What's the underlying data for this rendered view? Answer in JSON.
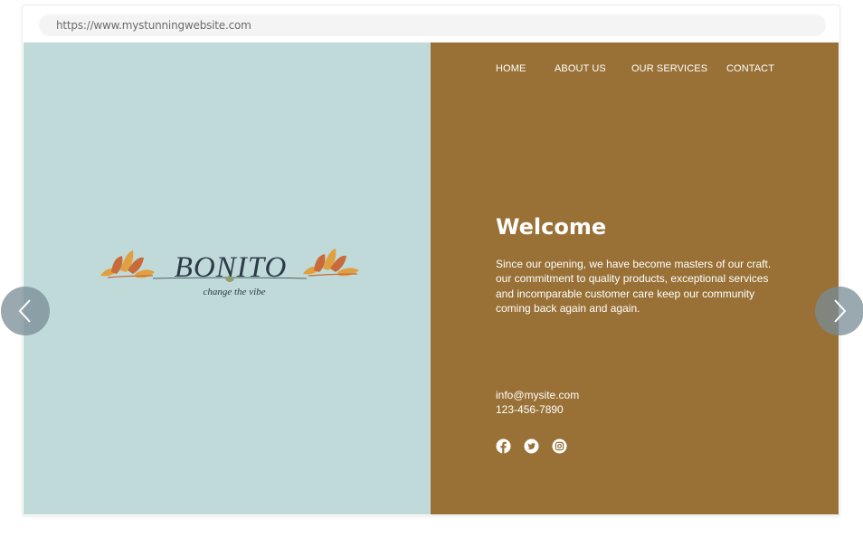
{
  "browser": {
    "url": "https://www.mystunningwebsite.com"
  },
  "site": {
    "logo": {
      "name": "BONITO",
      "tagline": "change the vibe"
    },
    "nav": {
      "home": "HOME",
      "about": "ABOUT US",
      "services": "OUR SERVICES",
      "contact": "CONTACT"
    },
    "welcome": {
      "title": "Welcome",
      "body": "Since our opening, we have become masters of our craft. our commitment to quality products, exceptional services and incomparable customer care keep our community coming back again and again."
    },
    "contact": {
      "email": "info@mysite.com",
      "phone": "123-456-7890"
    },
    "social": [
      "facebook-icon",
      "twitter-icon",
      "instagram-icon"
    ]
  },
  "colors": {
    "left_panel": "#bfdad8",
    "right_panel": "#997136",
    "logo_text": "#2e3a4a",
    "leaf_orange": "#e0a040",
    "leaf_rust": "#c86a3a"
  },
  "carousel": {
    "prev_icon": "chevron-left-icon",
    "next_icon": "chevron-right-icon"
  }
}
